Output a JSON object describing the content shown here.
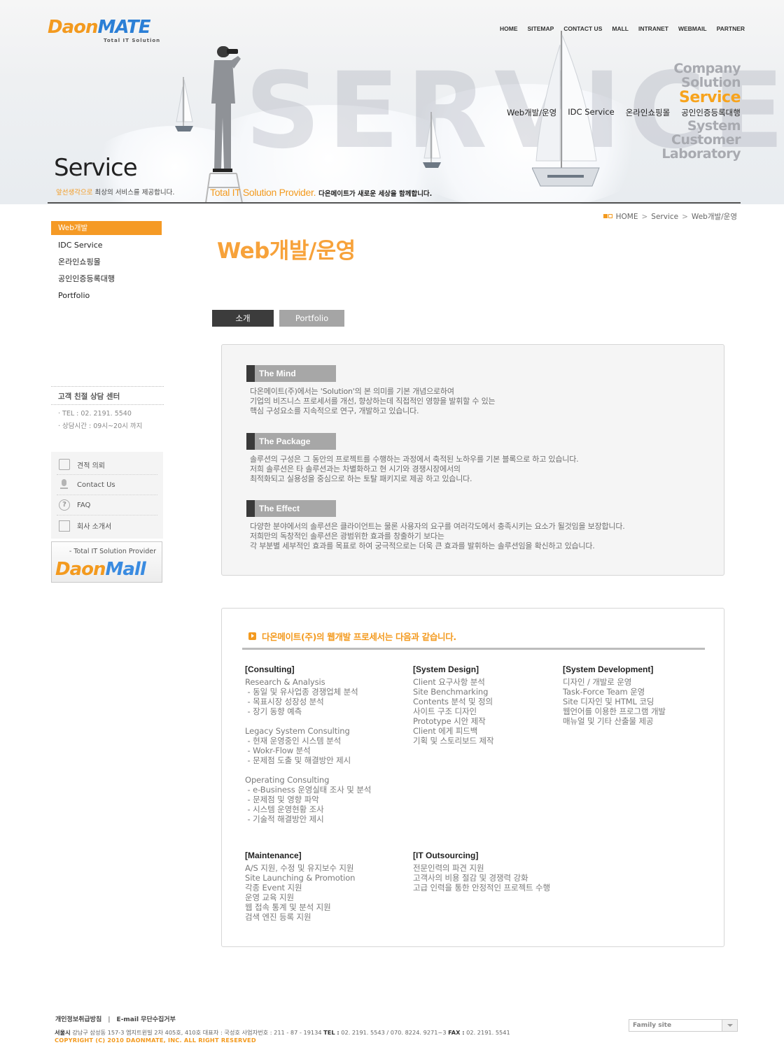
{
  "logo": {
    "part1": "Daon",
    "part2": "MATE",
    "tagline": "Total IT Solution"
  },
  "topnav": [
    "HOME",
    "SITEMAP",
    "CONTACT US",
    "MALL",
    "INTRANET",
    "WEBMAIL",
    "PARTNER"
  ],
  "main_menu": {
    "items": [
      "Company",
      "Solution",
      "Service",
      "System",
      "Customer",
      "Laboratory"
    ],
    "active": "Service"
  },
  "service_subnav": [
    "Web개발/운영",
    "IDC Service",
    "온라인쇼핑몰",
    "공인인증등록대행"
  ],
  "hero": {
    "background_word": "SERVICE",
    "section_title": "Service",
    "section_sub_highlight": "앞선생각으로",
    "section_sub_rest": " 최상의 서비스를 제공합니다.",
    "provider_text": "Total IT Solution Provider.",
    "provider_sub": "다온메이트가 새로운 세상을 함께합니다."
  },
  "breadcrumb": [
    "HOME",
    "Service",
    "Web개발/운영"
  ],
  "page_title": "Web개발/운영",
  "left_nav": {
    "items": [
      "Web개발",
      "IDC Service",
      "온라인쇼핑몰",
      "공인인증등록대행",
      "Portfolio"
    ],
    "active": "Web개발"
  },
  "consult_center": {
    "title": "고객 친절 상담 센터",
    "tel": "· TEL : 02. 2191. 5540",
    "hours": "· 상담시간 : 09시~20시 까지"
  },
  "quick_links": [
    {
      "icon": "folder-icon",
      "label": "견적 의뢰"
    },
    {
      "icon": "microphone-icon",
      "label": "Contact Us"
    },
    {
      "icon": "question-icon",
      "label": "FAQ"
    },
    {
      "icon": "document-icon",
      "label": "회사 소개서"
    }
  ],
  "mall_banner": {
    "tagline": "- Total IT Solution Provider",
    "logo_part1": "Daon",
    "logo_part2": "Mall"
  },
  "tabs": [
    {
      "label": "소개",
      "active": true
    },
    {
      "label": "Portfolio",
      "active": false
    }
  ],
  "intro_sections": [
    {
      "title": "The Mind",
      "lines": [
        "다온메이트(주)에서는 'Solution'의 본 의미를 기본 개념으로하여",
        "기업의 비즈니스 프로세서를 개선, 향상하는데 직접적인 영향을 발휘할 수 있는",
        "핵심 구성요소를 지속적으로 연구, 개발하고 있습니다."
      ]
    },
    {
      "title": "The Package",
      "lines": [
        "솔루션의 구성은 그 동안의 프로젝트를 수행하는 과정에서 축적된 노하우를 기본 블록으로 하고 있습니다.",
        "저희 솔루션은 타 솔루션과는 차별화하고 현 시기와 경쟁시장에서의",
        "최적화되고 실용성을 중심으로 하는 토탈  패키지로 제공 하고 있습니다."
      ]
    },
    {
      "title": "The Effect",
      "lines": [
        "다양한 분야에서의 솔루션은 클라이언트는 물론 사용자의 요구를 여러각도에서 충족시키는 요소가 될것임을 보장합니다.",
        "저희만의 독창적인 솔루션은 광범위한 효과를 창출하기 보다는",
        "각 부분별 세부적인 효과를 목표로 하여 궁극적으로는 더욱 큰 효과를 발휘하는 솔루션임을 확신하고 있습니다."
      ]
    }
  ],
  "process": {
    "title": "다온메이트(주)의 웹개발 프로세서는 다음과 같습니다.",
    "columns": [
      {
        "heading": "[Consulting]",
        "groups": [
          [
            "Research & Analysis",
            " - 동일 및 유사업종 경쟁업체 분석",
            " - 목표시장 성장성 분석",
            " - 장기 동향 예측"
          ],
          [
            "Legacy System Consulting",
            " - 현재 운영중인 시스템 분석",
            " - Wokr-Flow 분석",
            " - 문제점 도출 및 해결방안 제시"
          ],
          [
            "Operating Consulting",
            " - e-Business 운영실태 조사 및 분석",
            " - 문제점 및 영향 파악",
            " - 시스템 운영현황 조사",
            " - 기술적 해결방안 제시"
          ]
        ]
      },
      {
        "heading": "[System Design]",
        "groups": [
          [
            "Client 요구사항 분석",
            "Site Benchmarking",
            "Contents 분석 및 정의",
            "사이트 구조 디자인",
            "Prototype 시안 제작",
            "Client 에게 피드백",
            "기획 및 스토리보드 제작"
          ]
        ]
      },
      {
        "heading": "[System Development]",
        "groups": [
          [
            "디자인 / 개발로 운영",
            "Task-Force Team 운영",
            "Site 디자인 및 HTML 코딩",
            "웹언어를 이용한 프로그램 개발",
            "매뉴얼 및 기타 산출물 제공"
          ]
        ]
      },
      {
        "heading": "[Maintenance]",
        "groups": [
          [
            "A/S 지원, 수정 및 유지보수 지원",
            "Site Launching & Promotion",
            "각종 Event 지원",
            "운영 교육 지원",
            "웹 접속 통계 및 분석 지원",
            "검색 엔진 등록 지원"
          ]
        ]
      },
      {
        "heading": "[IT Outsourcing]",
        "groups": [
          [
            "전문인력의 파견 지원",
            "고객사의 비용 절감 및 경쟁력 강화",
            "고급 인력을 통한 안정적인 프로젝트 수행"
          ]
        ]
      }
    ]
  },
  "footer": {
    "links": [
      "개인정보취급방침",
      "E-mail 무단수집거부"
    ],
    "address_prefix": "서울시",
    "address": " 강남구 삼성동 157-3 엠지트윈빌 2차 405호, 410호    대표자 : 국성호    사업자번호 : 211 - 87 - 19134    ",
    "tel_label": "TEL :",
    "tel": " 02. 2191. 5543  /  070. 8224. 9271~3    ",
    "fax_label": "FAX :",
    "fax": " 02. 2191. 5541",
    "copyright": "COPYRIGHT (C) 2010 DAONMATE, INC. ALL RIGHT RESERVED",
    "family_site": "Family site"
  },
  "colors": {
    "accent": "#f39a1f",
    "dark": "#3c3c3c",
    "gray_tab": "#a5a5a5",
    "logo_blue": "#2b7fd6"
  }
}
